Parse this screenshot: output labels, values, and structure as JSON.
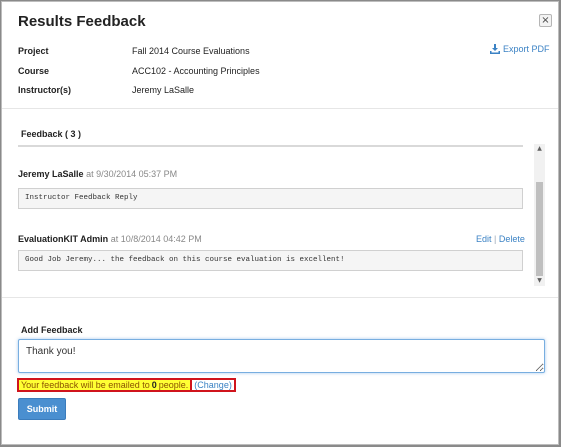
{
  "dialog": {
    "title": "Results Feedback",
    "close_glyph": "×",
    "export_label": "Export PDF"
  },
  "info": [
    {
      "label": "Project",
      "value": "Fall 2014 Course Evaluations"
    },
    {
      "label": "Course",
      "value": "ACC102 - Accounting Principles"
    },
    {
      "label": "Instructor(s)",
      "value": "Jeremy LaSalle"
    }
  ],
  "feedback": {
    "header": "Feedback ( 3 )",
    "entries": [
      {
        "author": "Jeremy LaSalle",
        "date_text": "at 9/30/2014 05:37 PM",
        "text": "Instructor Feedback Reply"
      },
      {
        "author": "EvaluationKIT Admin",
        "date_text": "at 10/8/2014 04:42 PM",
        "text": "Good Job Jeremy... the feedback on this course evaluation is excellent!"
      }
    ],
    "edit_label": "Edit",
    "delete_label": "Delete",
    "separator": "|"
  },
  "add_feedback": {
    "label": "Add Feedback",
    "value": "Thank you!",
    "notice_prefix": "Your feedback will be emailed to",
    "notice_count": "0",
    "notice_suffix": "people.",
    "change_label": "(Change)",
    "submit_label": "Submit"
  },
  "colors": {
    "accent": "#3b82c4",
    "submit_bg": "#4a8fd0",
    "highlight": "#ffff33",
    "highlight_border": "#d0141c"
  },
  "icons": {
    "export": "download-icon",
    "close": "close-icon"
  }
}
